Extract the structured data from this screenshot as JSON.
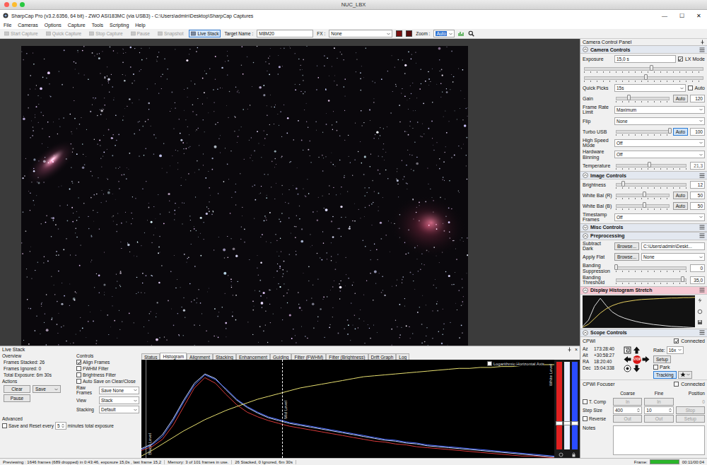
{
  "host": {
    "title": "NUC_LBX"
  },
  "window": {
    "title": "SharpCap Pro (v3.2.6356, 64 bit) - ZWO ASI183MC (via USB3) - C:\\Users\\admin\\Desktop\\SharpCap Captures",
    "controls": [
      "—",
      "☐",
      "✕"
    ]
  },
  "menu": [
    "File",
    "Cameras",
    "Options",
    "Capture",
    "Tools",
    "Scripting",
    "Help"
  ],
  "toolbar": {
    "buttons": [
      {
        "label": "Start Capture",
        "disabled": true,
        "checked": false
      },
      {
        "label": "Quick Capture",
        "disabled": true,
        "checked": false
      },
      {
        "label": "Stop Capture",
        "disabled": true,
        "checked": false
      },
      {
        "label": "Pause",
        "disabled": true,
        "checked": false
      },
      {
        "label": "Snapshot",
        "disabled": true,
        "checked": false
      },
      {
        "label": "Live Stack",
        "disabled": false,
        "checked": true
      }
    ],
    "target": {
      "label": "Target Name :",
      "value": "M8M20"
    },
    "fx": {
      "label": "FX :",
      "value": "None"
    },
    "zoom": {
      "label": "Zoom :",
      "value": "Auto"
    }
  },
  "camera_panel": {
    "title": "Camera Control Panel",
    "sections": [
      {
        "title": "Camera Controls",
        "expanded": true,
        "color": "#e3e8f0",
        "rows": [
          {
            "kind": "input",
            "label": "Exposure",
            "value": "15,0 s",
            "check": {
              "label": "LX Mode",
              "checked": true
            }
          },
          {
            "kind": "track",
            "level": 0.55
          },
          {
            "kind": "track",
            "level": 0.5
          },
          {
            "kind": "select",
            "label": "Quick Picks",
            "value": "15s",
            "check": {
              "label": "Auto",
              "checked": false
            }
          },
          {
            "kind": "slider",
            "label": "Gain",
            "level": 0.22,
            "auto": {
              "label": "Auto",
              "on": false
            },
            "value": "120"
          },
          {
            "kind": "select",
            "label": "Frame Rate Limit",
            "value": "Maximum"
          },
          {
            "kind": "select",
            "label": "Flip",
            "value": "None"
          },
          {
            "kind": "slider",
            "label": "Turbo USB",
            "level": 1.0,
            "auto": {
              "label": "Auto",
              "on": true
            },
            "value": "100"
          },
          {
            "kind": "select",
            "label": "High Speed Mode",
            "value": "Off"
          },
          {
            "kind": "select",
            "label": "Hardware Binning",
            "value": "Off"
          },
          {
            "kind": "slider",
            "label": "Temperature",
            "level": 0.45,
            "value": "21,3"
          }
        ]
      },
      {
        "title": "Image Controls",
        "expanded": true,
        "color": "#e3e8f0",
        "rows": [
          {
            "kind": "slider",
            "label": "Brightness",
            "level": 0.1,
            "value": "12"
          },
          {
            "kind": "slider",
            "label": "White Bal (R)",
            "level": 0.5,
            "auto": {
              "label": "Auto",
              "on": false
            },
            "value": "50"
          },
          {
            "kind": "slider",
            "label": "White Bal (B)",
            "level": 0.5,
            "auto": {
              "label": "Auto",
              "on": false
            },
            "value": "50"
          },
          {
            "kind": "select",
            "label": "Timestamp Frames",
            "value": "Off"
          }
        ]
      },
      {
        "title": "Misc Controls",
        "expanded": false,
        "color": "#e3e8f0",
        "rows": []
      },
      {
        "title": "Preprocessing",
        "expanded": true,
        "color": "#e3e8f0",
        "rows": [
          {
            "kind": "browse",
            "label": "Subtract Dark",
            "button": "Browse...",
            "value": "C:\\Users\\admin\\Deskt..."
          },
          {
            "kind": "browse_select",
            "label": "Apply Flat",
            "button": "Browse...",
            "value": "None"
          },
          {
            "kind": "slider",
            "label": "Banding Suppression",
            "level": 0.0,
            "value": "0"
          },
          {
            "kind": "slider",
            "label": "Banding Threshold",
            "level": 0.9,
            "value": "35,0"
          }
        ]
      },
      {
        "title": "Display Histogram Stretch",
        "expanded": true,
        "color": "#f6c9d3",
        "rows": [
          {
            "kind": "stretch",
            "series": [
              {
                "color": "#e0e0e0",
                "values": [
                  5,
                  25,
                  70,
                  96,
                  72,
                  52,
                  40,
                  32,
                  26,
                  21,
                  17,
                  14,
                  11,
                  9,
                  7,
                  5,
                  4,
                  3,
                  2,
                  1
                ]
              },
              {
                "color": "#e8d060",
                "values": [
                  2,
                  12,
                  30,
                  48,
                  62,
                  72,
                  79,
                  84,
                  87,
                  90,
                  92,
                  93,
                  94,
                  95,
                  96,
                  97,
                  97,
                  98,
                  98,
                  99
                ]
              }
            ]
          }
        ]
      }
    ]
  },
  "scope": {
    "title": "Scope Controls",
    "expanded": true,
    "color": "#e3e8f0",
    "mount": "CPWI",
    "connected": {
      "label": "Connected",
      "checked": true
    },
    "coords": [
      {
        "label": "Az",
        "value": "173:28:40"
      },
      {
        "label": "Alt",
        "value": "+30:58:27"
      },
      {
        "label": "RA",
        "value": "18:20:40"
      },
      {
        "label": "Dec",
        "value": "15:04:338"
      }
    ],
    "rate_label": "Rate:",
    "rate": "16x",
    "stop": "STOP",
    "setup": "Setup",
    "park": {
      "label": "Park",
      "checked": false
    },
    "tracking": {
      "label": "Tracking",
      "on": true
    }
  },
  "focuser": {
    "title": "CPWI Focuser",
    "connected": {
      "label": "Connected",
      "checked": false
    },
    "disabled": true,
    "headers": [
      "Coarse",
      "Fine",
      "Position"
    ],
    "rows": [
      {
        "kind": "check",
        "label": "T. Comp",
        "check": false,
        "cells": [
          {
            "kind": "button",
            "text": "In"
          },
          {
            "kind": "button",
            "text": "In"
          },
          {
            "kind": "value",
            "text": "0"
          }
        ]
      },
      {
        "kind": "plain",
        "label": "Step Size",
        "cells": [
          {
            "kind": "spin",
            "text": "400"
          },
          {
            "kind": "spin",
            "text": "10"
          },
          {
            "kind": "button",
            "text": "Stop"
          }
        ]
      },
      {
        "kind": "check",
        "label": "Reverse",
        "check": false,
        "cells": [
          {
            "kind": "button",
            "text": "Out"
          },
          {
            "kind": "button",
            "text": "Out"
          },
          {
            "kind": "button",
            "text": "Setup"
          }
        ]
      }
    ]
  },
  "notes": {
    "label": "Notes"
  },
  "live_stack": {
    "title": "Live Stack",
    "close": "×",
    "overview": {
      "title": "Overview",
      "lines": [
        "Frames Stacked: 26",
        "Frames Ignored: 0",
        "Total Exposure: 6m 30s"
      ]
    },
    "actions": {
      "title": "Actions",
      "clear": "Clear",
      "save": "Save",
      "pause": "Pause"
    },
    "controls": {
      "title": "Controls",
      "checks": [
        {
          "label": "Align Frames",
          "checked": true
        },
        {
          "label": "FWHM Filter",
          "checked": false
        },
        {
          "label": "Brightness Filter",
          "checked": false
        },
        {
          "label": "Auto Save on Clear/Close",
          "checked": false
        }
      ],
      "selects": [
        {
          "label": "Raw Frames",
          "value": "Save None"
        },
        {
          "label": "View",
          "value": "Stack"
        },
        {
          "label": "Stacking",
          "value": "Default"
        }
      ]
    },
    "advanced": {
      "title": "Advanced",
      "check": {
        "label": "Save and Reset every",
        "checked": false
      },
      "value": "5",
      "suffix": "minutes total exposure"
    },
    "tabs": [
      {
        "label": "Status",
        "selected": false
      },
      {
        "label": "Histogram",
        "selected": true
      },
      {
        "label": "Alignment",
        "selected": false
      },
      {
        "label": "Stacking",
        "selected": false
      },
      {
        "label": "Enhancement",
        "selected": false
      },
      {
        "label": "Guiding",
        "selected": false
      },
      {
        "label": "Filter (FWHM)",
        "selected": false
      },
      {
        "label": "Filter (Brightness)",
        "selected": false
      },
      {
        "label": "Drift Graph",
        "selected": false
      },
      {
        "label": "Log",
        "selected": false
      }
    ],
    "histogram": {
      "log_axis": {
        "label": "Logarithmic Horizontal Axis",
        "checked": true
      },
      "black_label": "Black Level",
      "mid_label": "Mid Level",
      "white_label": "White Level",
      "black_level": 0.01,
      "mid_level": 0.34,
      "series": [
        {
          "name": "red",
          "color": "#d83a3a",
          "values": [
            8,
            12,
            20,
            35,
            55,
            75,
            86,
            80,
            68,
            57,
            49,
            44,
            40,
            37,
            34,
            32,
            30,
            28,
            26,
            24,
            22,
            20,
            18,
            17,
            15,
            14,
            12,
            11,
            10,
            9,
            8,
            7,
            6,
            5,
            4,
            3,
            2,
            2,
            1,
            0
          ]
        },
        {
          "name": "green",
          "color": "#c8d8ff",
          "values": [
            10,
            15,
            25,
            42,
            62,
            80,
            90,
            85,
            73,
            62,
            54,
            48,
            43,
            40,
            37,
            35,
            33,
            31,
            29,
            27,
            25,
            23,
            21,
            19,
            18,
            16,
            15,
            13,
            12,
            11,
            10,
            9,
            8,
            7,
            6,
            5,
            4,
            3,
            2,
            1
          ]
        },
        {
          "name": "blue",
          "color": "#4a6cff",
          "values": [
            9,
            14,
            23,
            40,
            60,
            78,
            89,
            84,
            74,
            63,
            55,
            49,
            44,
            41,
            38,
            36,
            34,
            32,
            30,
            28,
            26,
            24,
            22,
            20,
            19,
            17,
            16,
            14,
            13,
            12,
            11,
            10,
            9,
            8,
            7,
            6,
            5,
            4,
            3,
            2
          ]
        },
        {
          "name": "stretch",
          "color": "#e8e070",
          "values": [
            2,
            8,
            15,
            22,
            29,
            35,
            41,
            46,
            51,
            55,
            59,
            63,
            66,
            69,
            72,
            75,
            77,
            79,
            81,
            83,
            85,
            87,
            88,
            89,
            90,
            91,
            92,
            93,
            94,
            95,
            96,
            96,
            97,
            97,
            98,
            98,
            99,
            99,
            100,
            100
          ]
        }
      ],
      "channels": [
        {
          "color": "#e02020",
          "level": 0.3
        },
        {
          "color": "#e8eeff",
          "level": 0.3
        },
        {
          "color": "#2a4cff",
          "level": 0.3
        }
      ]
    }
  },
  "status_bar": {
    "text": "Previewing : 1646 frames (689 dropped) in 0:43:46, exposure 15,0s , last frame 15,2",
    "memory": "Memory: 3 of 101 frames in use.",
    "stack": "26 Stacked, 0 Ignored, 6m 30s",
    "frame_label": "Frame:",
    "frame_level": 1.0,
    "time": "00:11/00:04"
  }
}
